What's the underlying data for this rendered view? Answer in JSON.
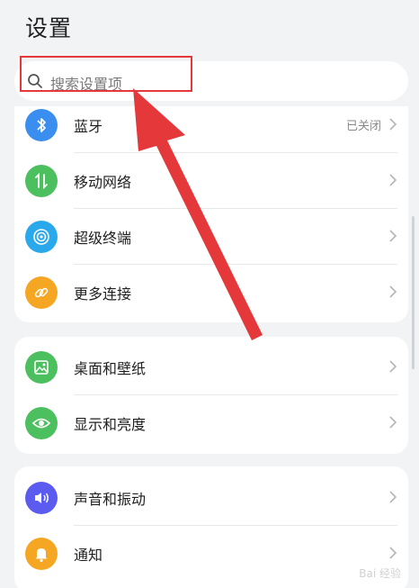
{
  "header": {
    "title": "设置"
  },
  "search": {
    "placeholder": "搜索设置项"
  },
  "groups": [
    {
      "items": [
        {
          "label": "蓝牙",
          "status": "已关闭",
          "icon": "bluetooth-icon",
          "color": "#3a8ef0"
        },
        {
          "label": "移动网络",
          "status": "",
          "icon": "mobile-data-icon",
          "color": "#4cbf5e"
        },
        {
          "label": "超级终端",
          "status": "",
          "icon": "super-device-icon",
          "color": "#2aa8ec"
        },
        {
          "label": "更多连接",
          "status": "",
          "icon": "link-icon",
          "color": "#f5a623"
        }
      ]
    },
    {
      "items": [
        {
          "label": "桌面和壁纸",
          "status": "",
          "icon": "wallpaper-icon",
          "color": "#4cbf5e"
        },
        {
          "label": "显示和亮度",
          "status": "",
          "icon": "eye-icon",
          "color": "#4cbf5e"
        }
      ]
    },
    {
      "items": [
        {
          "label": "声音和振动",
          "status": "",
          "icon": "sound-icon",
          "color": "#5b5bf0"
        },
        {
          "label": "通知",
          "status": "",
          "icon": "bell-icon",
          "color": "#f5a623"
        }
      ]
    }
  ],
  "annotation": {
    "arrow_color": "#e5383b",
    "box_color": "#e5383b"
  }
}
